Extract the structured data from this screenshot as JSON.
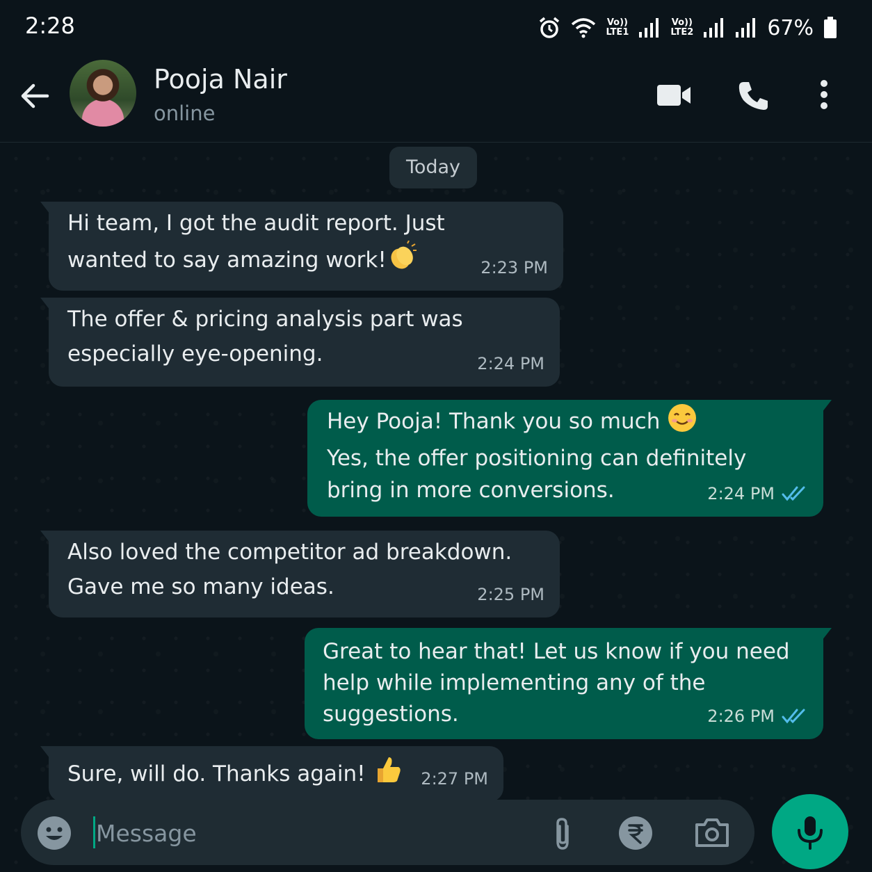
{
  "status_bar": {
    "time": "2:28",
    "sim1": "Vo)) LTE1",
    "sim2": "Vo)) LTE2",
    "battery": "67%",
    "icons": [
      "alarm-icon",
      "wifi-icon",
      "signal-icon",
      "battery-icon"
    ]
  },
  "header": {
    "contact_name": "Pooja Nair",
    "status": "online",
    "icons": [
      "back-arrow-icon",
      "video-call-icon",
      "phone-icon",
      "more-options-icon"
    ]
  },
  "chat": {
    "date_label": "Today",
    "messages": [
      {
        "direction": "in",
        "text": "Hi team, I got the audit report. Just\nwanted to say amazing work!",
        "emoji": "clapping-hands",
        "time": "2:23 PM"
      },
      {
        "direction": "in",
        "text": "The offer & pricing analysis part was\nespecially eye-opening.",
        "time": "2:24 PM"
      },
      {
        "direction": "out",
        "text": "Hey Pooja! Thank you so much",
        "emoji": "smiling-face",
        "text2": "Yes, the offer positioning can definitely\nbring in more conversions.",
        "time": "2:24 PM",
        "read": true
      },
      {
        "direction": "in",
        "text": "Also loved the competitor ad breakdown.\nGave me so many ideas.",
        "time": "2:25 PM"
      },
      {
        "direction": "out",
        "text": "Great to hear that! Let us know if you need\nhelp while implementing any of the\nsuggestions.",
        "time": "2:26 PM",
        "read": true
      },
      {
        "direction": "in",
        "text": "Sure, will do. Thanks again!",
        "emoji": "thumbs-up",
        "time": "2:27 PM"
      }
    ]
  },
  "input": {
    "placeholder": "Message",
    "icons": [
      "emoji-icon",
      "attach-icon",
      "rupee-payment-icon",
      "camera-icon",
      "mic-icon"
    ]
  },
  "colors": {
    "background": "#0b141a",
    "incoming_bubble": "#1f2c34",
    "outgoing_bubble": "#005c4b",
    "accent": "#00a884",
    "read_ticks": "#53bdeb"
  }
}
